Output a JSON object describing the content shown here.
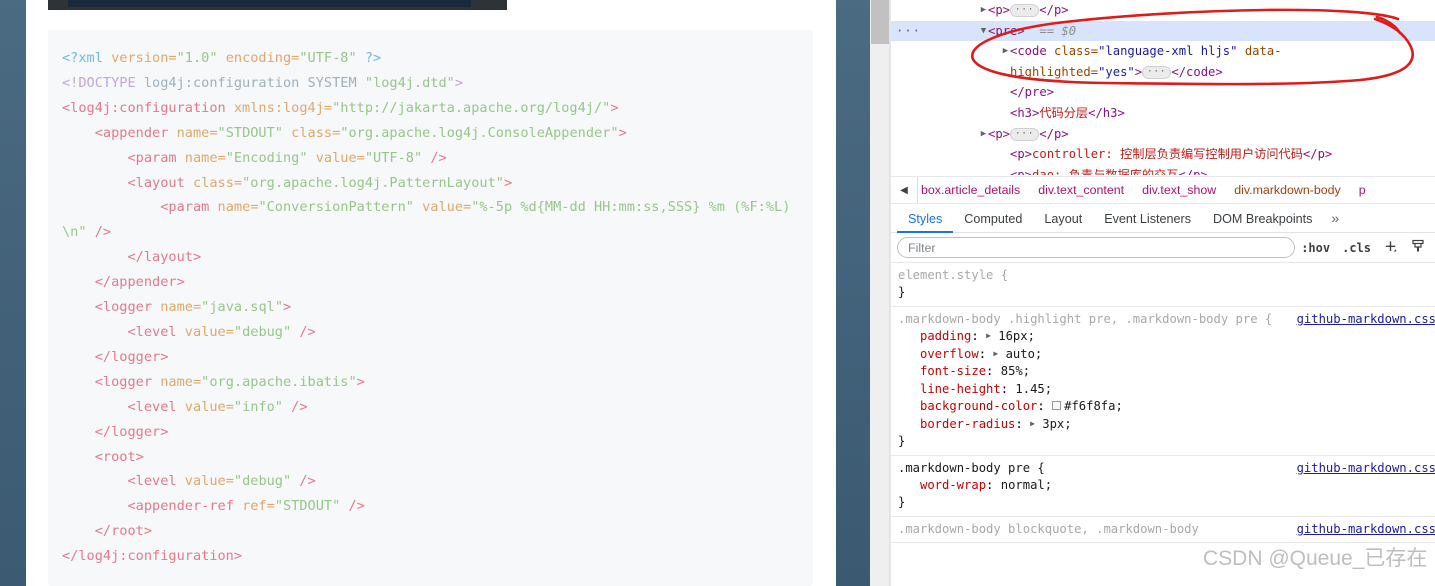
{
  "page": {
    "code_block": {
      "language": "xml",
      "lines": [
        [
          {
            "t": "meta",
            "v": "<?xml "
          },
          {
            "t": "attr",
            "v": "version="
          },
          {
            "t": "str",
            "v": "\"1.0\""
          },
          {
            "t": "attr",
            "v": " encoding="
          },
          {
            "t": "str",
            "v": "\"UTF-8\""
          },
          {
            "t": "meta",
            "v": " ?>"
          }
        ],
        [
          {
            "t": "dt",
            "v": "<!DOCTYPE "
          },
          {
            "t": "plain",
            "v": "log4j:configuration SYSTEM "
          },
          {
            "t": "str",
            "v": "\"log4j.dtd\""
          },
          {
            "t": "dt",
            "v": ">"
          }
        ],
        [
          {
            "t": "tag",
            "v": "<log4j:configuration "
          },
          {
            "t": "attr",
            "v": "xmlns:log4j="
          },
          {
            "t": "str",
            "v": "\"http://jakarta.apache.org/log4j/\""
          },
          {
            "t": "tag",
            "v": ">"
          }
        ],
        [
          {
            "t": "ind",
            "v": "    "
          },
          {
            "t": "tag",
            "v": "<appender "
          },
          {
            "t": "attr",
            "v": "name="
          },
          {
            "t": "str",
            "v": "\"STDOUT\""
          },
          {
            "t": "attr",
            "v": " class="
          },
          {
            "t": "str",
            "v": "\"org.apache.log4j.ConsoleAppender\""
          },
          {
            "t": "tag",
            "v": ">"
          }
        ],
        [
          {
            "t": "ind",
            "v": "        "
          },
          {
            "t": "tag",
            "v": "<param "
          },
          {
            "t": "attr",
            "v": "name="
          },
          {
            "t": "str",
            "v": "\"Encoding\""
          },
          {
            "t": "attr",
            "v": " value="
          },
          {
            "t": "str",
            "v": "\"UTF-8\""
          },
          {
            "t": "tag",
            "v": " />"
          }
        ],
        [
          {
            "t": "ind",
            "v": "        "
          },
          {
            "t": "tag",
            "v": "<layout "
          },
          {
            "t": "attr",
            "v": "class="
          },
          {
            "t": "str",
            "v": "\"org.apache.log4j.PatternLayout\""
          },
          {
            "t": "tag",
            "v": ">"
          }
        ],
        [
          {
            "t": "ind",
            "v": "            "
          },
          {
            "t": "tag",
            "v": "<param "
          },
          {
            "t": "attr",
            "v": "name="
          },
          {
            "t": "str",
            "v": "\"ConversionPattern\""
          },
          {
            "t": "attr",
            "v": " value="
          },
          {
            "t": "str",
            "v": "\"%-5p %d{MM-dd HH:mm:ss,SSS} %m (%F:%L) \\n\""
          },
          {
            "t": "tag",
            "v": " />"
          }
        ],
        [
          {
            "t": "ind",
            "v": "        "
          },
          {
            "t": "tag",
            "v": "</layout>"
          }
        ],
        [
          {
            "t": "ind",
            "v": "    "
          },
          {
            "t": "tag",
            "v": "</appender>"
          }
        ],
        [
          {
            "t": "ind",
            "v": "    "
          },
          {
            "t": "tag",
            "v": "<logger "
          },
          {
            "t": "attr",
            "v": "name="
          },
          {
            "t": "str",
            "v": "\"java.sql\""
          },
          {
            "t": "tag",
            "v": ">"
          }
        ],
        [
          {
            "t": "ind",
            "v": "        "
          },
          {
            "t": "tag",
            "v": "<level "
          },
          {
            "t": "attr",
            "v": "value="
          },
          {
            "t": "str",
            "v": "\"debug\""
          },
          {
            "t": "tag",
            "v": " />"
          }
        ],
        [
          {
            "t": "ind",
            "v": "    "
          },
          {
            "t": "tag",
            "v": "</logger>"
          }
        ],
        [
          {
            "t": "ind",
            "v": "    "
          },
          {
            "t": "tag",
            "v": "<logger "
          },
          {
            "t": "attr",
            "v": "name="
          },
          {
            "t": "str",
            "v": "\"org.apache.ibatis\""
          },
          {
            "t": "tag",
            "v": ">"
          }
        ],
        [
          {
            "t": "ind",
            "v": "        "
          },
          {
            "t": "tag",
            "v": "<level "
          },
          {
            "t": "attr",
            "v": "value="
          },
          {
            "t": "str",
            "v": "\"info\""
          },
          {
            "t": "tag",
            "v": " />"
          }
        ],
        [
          {
            "t": "ind",
            "v": "    "
          },
          {
            "t": "tag",
            "v": "</logger>"
          }
        ],
        [
          {
            "t": "ind",
            "v": "    "
          },
          {
            "t": "tag",
            "v": "<root>"
          }
        ],
        [
          {
            "t": "ind",
            "v": "        "
          },
          {
            "t": "tag",
            "v": "<level "
          },
          {
            "t": "attr",
            "v": "value="
          },
          {
            "t": "str",
            "v": "\"debug\""
          },
          {
            "t": "tag",
            "v": " />"
          }
        ],
        [
          {
            "t": "ind",
            "v": "        "
          },
          {
            "t": "tag",
            "v": "<appender-ref "
          },
          {
            "t": "attr",
            "v": "ref="
          },
          {
            "t": "str",
            "v": "\"STDOUT\""
          },
          {
            "t": "tag",
            "v": " />"
          }
        ],
        [
          {
            "t": "ind",
            "v": "    "
          },
          {
            "t": "tag",
            "v": "</root>"
          }
        ],
        [
          {
            "t": "tag",
            "v": "</log4j:configuration>"
          }
        ]
      ]
    }
  },
  "devtools": {
    "dom_tree": [
      {
        "indent": 3,
        "caret": "right",
        "selected": false,
        "parts": [
          {
            "t": "tag",
            "v": "<p>"
          },
          {
            "t": "ellipsis",
            "v": "···"
          },
          {
            "t": "tag",
            "v": "</p>"
          }
        ]
      },
      {
        "indent": 3,
        "caret": "down",
        "selected": true,
        "left_dots": "···",
        "parts": [
          {
            "t": "tag",
            "v": "<pre>"
          },
          {
            "t": "sel",
            "v": "  == $0"
          }
        ]
      },
      {
        "indent": 4,
        "caret": "right",
        "selected": false,
        "parts": [
          {
            "t": "tag",
            "v": "<code "
          },
          {
            "t": "attr",
            "v": "class="
          },
          {
            "t": "val",
            "v": "\"language-xml hljs\""
          },
          {
            "t": "attr",
            "v": " data-"
          }
        ]
      },
      {
        "indent": 4,
        "caret": "none",
        "selected": false,
        "parts": [
          {
            "t": "attr",
            "v": "highlighted="
          },
          {
            "t": "val",
            "v": "\"yes\""
          },
          {
            "t": "tag",
            "v": ">"
          },
          {
            "t": "ellipsis",
            "v": "···"
          },
          {
            "t": "tag",
            "v": "</code>"
          }
        ]
      },
      {
        "indent": 4,
        "caret": "none",
        "selected": false,
        "parts": [
          {
            "t": "tag",
            "v": "</pre>"
          }
        ]
      },
      {
        "indent": 4,
        "caret": "none",
        "selected": false,
        "parts": [
          {
            "t": "tag",
            "v": "<h3>"
          },
          {
            "t": "text",
            "v": "代码分层"
          },
          {
            "t": "tag",
            "v": "</h3>"
          }
        ]
      },
      {
        "indent": 3,
        "caret": "right",
        "selected": false,
        "parts": [
          {
            "t": "tag",
            "v": "<p>"
          },
          {
            "t": "ellipsis",
            "v": "···"
          },
          {
            "t": "tag",
            "v": "</p>"
          }
        ]
      },
      {
        "indent": 4,
        "caret": "none",
        "selected": false,
        "parts": [
          {
            "t": "tag",
            "v": "<p>"
          },
          {
            "t": "text",
            "v": "controller: 控制层负责编写控制用户访问代码"
          },
          {
            "t": "tag",
            "v": "</p>"
          }
        ]
      },
      {
        "indent": 4,
        "caret": "none",
        "selected": false,
        "parts": [
          {
            "t": "tag",
            "v": "<p>"
          },
          {
            "t": "text",
            "v": "dao: 负责与数据库的交互"
          },
          {
            "t": "tag",
            "v": "</p>"
          }
        ]
      }
    ],
    "breadcrumb": {
      "back_icon": "◀",
      "items": [
        {
          "label": "box.article_details",
          "truncated": true
        },
        {
          "label": "div.text_content"
        },
        {
          "label": "div.text_show"
        },
        {
          "label": "div.markdown-body"
        },
        {
          "label": "p"
        }
      ]
    },
    "tabs": {
      "items": [
        "Styles",
        "Computed",
        "Layout",
        "Event Listeners",
        "DOM Breakpoints"
      ],
      "active": "Styles",
      "overflow_label": "»"
    },
    "filter": {
      "placeholder": "Filter",
      "value": "",
      "hov_label": ":hov",
      "cls_label": ".cls",
      "new_rule_icon": "+",
      "print_icon": "print-style-icon"
    },
    "styles_rules": [
      {
        "selector": "element.style {",
        "selector_faded": false,
        "source": "",
        "declarations": [],
        "close": "}"
      },
      {
        "selector": ".markdown-body .highlight pre, .markdown-body pre {",
        "selector_faded": true,
        "source": "github-markdown.css",
        "declarations": [
          {
            "prop": "padding",
            "value": "16px",
            "expandable": true,
            "swatch": null
          },
          {
            "prop": "overflow",
            "value": "auto",
            "expandable": true,
            "swatch": null
          },
          {
            "prop": "font-size",
            "value": "85%",
            "expandable": false,
            "swatch": null
          },
          {
            "prop": "line-height",
            "value": "1.45",
            "expandable": false,
            "swatch": null
          },
          {
            "prop": "background-color",
            "value": "#f6f8fa",
            "expandable": false,
            "swatch": "#f6f8fa"
          },
          {
            "prop": "border-radius",
            "value": "3px",
            "expandable": true,
            "swatch": null
          }
        ],
        "close": "}"
      },
      {
        "selector": ".markdown-body pre {",
        "selector_faded": false,
        "source": "github-markdown.css",
        "declarations": [
          {
            "prop": "word-wrap",
            "value": "normal",
            "expandable": false,
            "swatch": null
          }
        ],
        "close": "}"
      },
      {
        "selector": ".markdown-body blockquote, .markdown-body",
        "selector_faded": true,
        "source": "github-markdown.css",
        "declarations": [],
        "close": ""
      }
    ]
  },
  "watermark": {
    "text": "CSDN @Queue_已存在"
  },
  "colors": {
    "rail": "#46657d",
    "code_bg": "#f6f8fa",
    "selected_row": "#d7e4fb",
    "accent": "#1a73e8",
    "annotation": "#e01b1b",
    "background_color_value": "#f6f8fa"
  }
}
